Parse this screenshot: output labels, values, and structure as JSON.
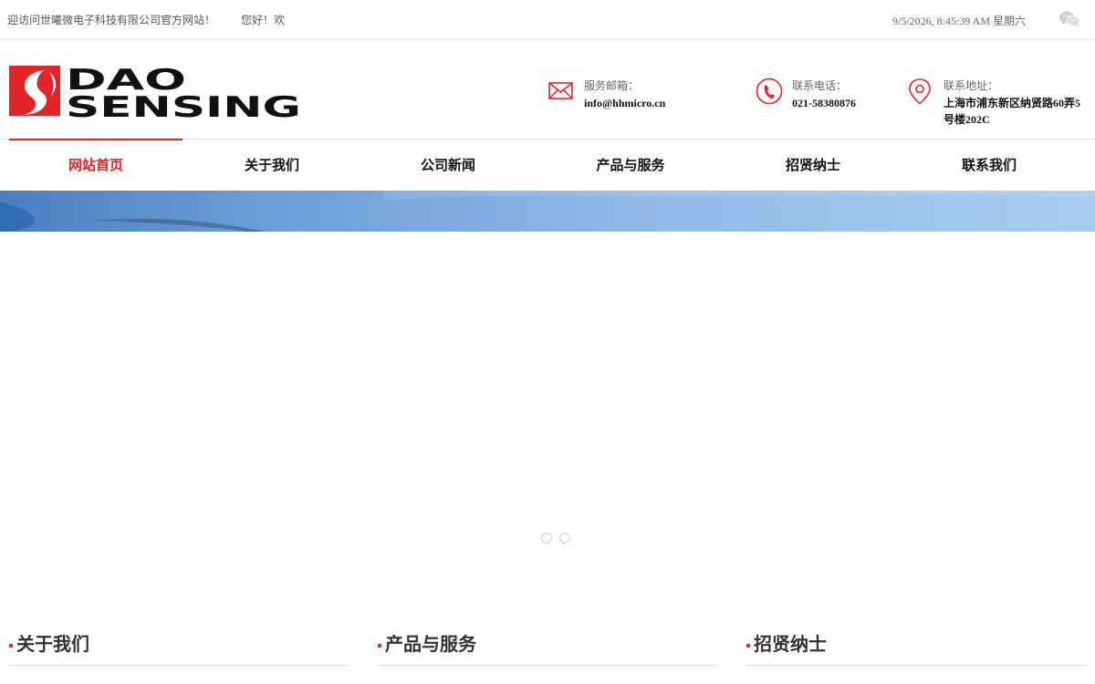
{
  "topbar": {
    "welcome": "迎访问世曦微电子科技有限公司官方网站！",
    "greeting": "您好！欢",
    "datetime": "9/5/2026, 8:45:39 AM 星期六",
    "wechat_icon": "wechat-icon"
  },
  "header": {
    "logo_text_line1": "DAO",
    "logo_text_line2": "SENSING",
    "brand_color": "#e0242a",
    "contacts": [
      {
        "icon": "mail-icon",
        "label": "服务邮箱：",
        "value": "info@hhmicro.cn"
      },
      {
        "icon": "phone-icon",
        "label": "联系电话：",
        "value": "021-58380876"
      },
      {
        "icon": "location-icon",
        "label": "联系地址：",
        "value": "上海市浦东新区纳贤路60弄5号楼202C"
      }
    ]
  },
  "nav": {
    "items": [
      {
        "label": "网站首页",
        "active": true
      },
      {
        "label": "关于我们",
        "active": false
      },
      {
        "label": "公司新闻",
        "active": false
      },
      {
        "label": "产品与服务",
        "active": false
      },
      {
        "label": "招贤纳士",
        "active": false
      },
      {
        "label": "联系我们",
        "active": false
      }
    ]
  },
  "slider": {
    "dot_count": 2
  },
  "sections": [
    {
      "title": "关于我们"
    },
    {
      "title": "产品与服务"
    },
    {
      "title": "招贤纳士"
    }
  ]
}
